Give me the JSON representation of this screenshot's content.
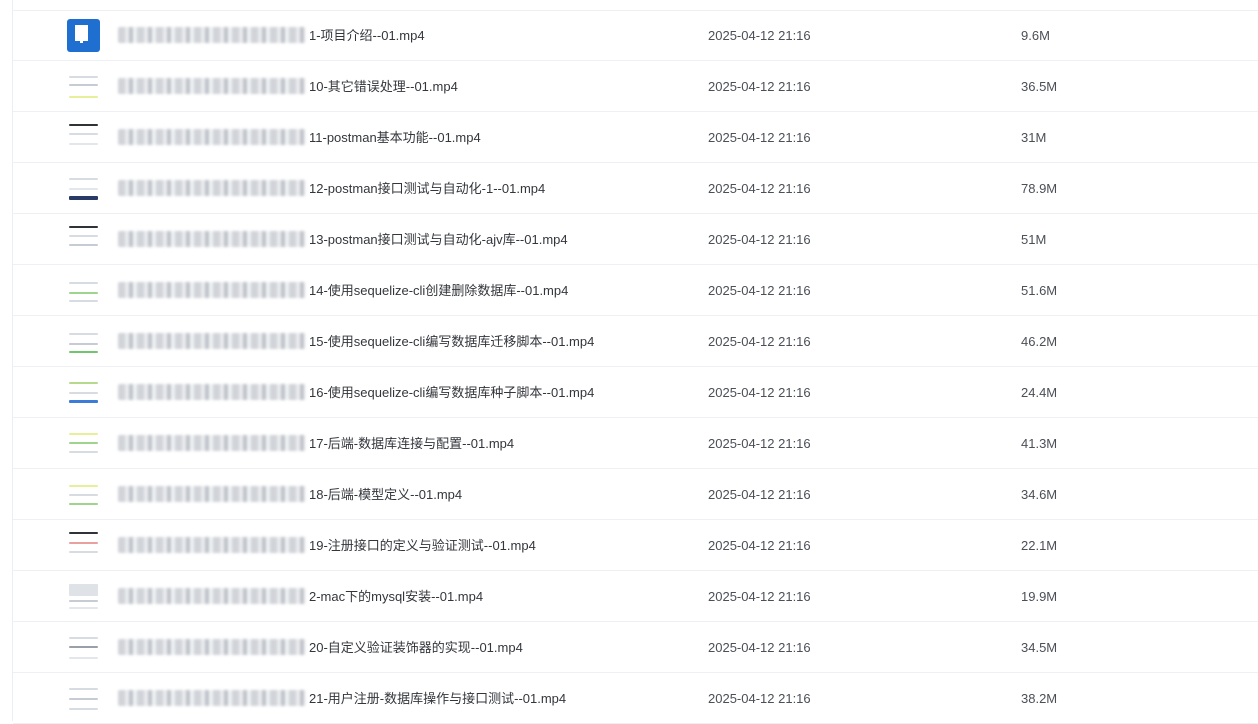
{
  "files": [
    {
      "name": "1-项目介绍--01.mp4",
      "date": "2025-04-12 21:16",
      "size": "9.6M",
      "thumb_icon": "video-file-icon"
    },
    {
      "name": "10-其它错误处理--01.mp4",
      "date": "2025-04-12 21:16",
      "size": "36.5M",
      "thumb_icon": "video-thumbnail"
    },
    {
      "name": "11-postman基本功能--01.mp4",
      "date": "2025-04-12 21:16",
      "size": "31M",
      "thumb_icon": "video-thumbnail"
    },
    {
      "name": "12-postman接口测试与自动化-1--01.mp4",
      "date": "2025-04-12 21:16",
      "size": "78.9M",
      "thumb_icon": "video-thumbnail"
    },
    {
      "name": "13-postman接口测试与自动化-ajv库--01.mp4",
      "date": "2025-04-12 21:16",
      "size": "51M",
      "thumb_icon": "video-thumbnail"
    },
    {
      "name": "14-使用sequelize-cli创建删除数据库--01.mp4",
      "date": "2025-04-12 21:16",
      "size": "51.6M",
      "thumb_icon": "video-thumbnail"
    },
    {
      "name": "15-使用sequelize-cli编写数据库迁移脚本--01.mp4",
      "date": "2025-04-12 21:16",
      "size": "46.2M",
      "thumb_icon": "video-thumbnail"
    },
    {
      "name": "16-使用sequelize-cli编写数据库种子脚本--01.mp4",
      "date": "2025-04-12 21:16",
      "size": "24.4M",
      "thumb_icon": "video-thumbnail"
    },
    {
      "name": "17-后端-数据库连接与配置--01.mp4",
      "date": "2025-04-12 21:16",
      "size": "41.3M",
      "thumb_icon": "video-thumbnail"
    },
    {
      "name": "18-后端-模型定义--01.mp4",
      "date": "2025-04-12 21:16",
      "size": "34.6M",
      "thumb_icon": "video-thumbnail"
    },
    {
      "name": "19-注册接口的定义与验证测试--01.mp4",
      "date": "2025-04-12 21:16",
      "size": "22.1M",
      "thumb_icon": "video-thumbnail"
    },
    {
      "name": "2-mac下的mysql安装--01.mp4",
      "date": "2025-04-12 21:16",
      "size": "19.9M",
      "thumb_icon": "video-thumbnail"
    },
    {
      "name": "20-自定义验证装饰器的实现--01.mp4",
      "date": "2025-04-12 21:16",
      "size": "34.5M",
      "thumb_icon": "video-thumbnail"
    },
    {
      "name": "21-用户注册-数据库操作与接口测试--01.mp4",
      "date": "2025-04-12 21:16",
      "size": "38.2M",
      "thumb_icon": "video-thumbnail"
    }
  ]
}
